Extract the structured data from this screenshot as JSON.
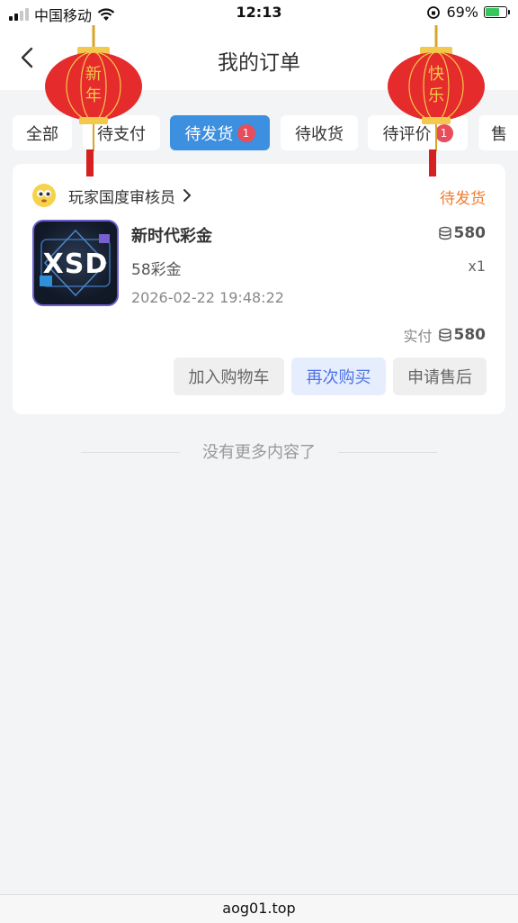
{
  "status_bar": {
    "carrier": "中国移动",
    "time": "12:13",
    "battery_percent": "69%",
    "battery_level": 0.69
  },
  "nav": {
    "title": "我的订单"
  },
  "decor": {
    "lantern_left": [
      "新",
      "年"
    ],
    "lantern_right": [
      "快",
      "乐"
    ]
  },
  "tabs": [
    {
      "label": "全部",
      "badge": ""
    },
    {
      "label": "待支付",
      "badge": ""
    },
    {
      "label": "待发货",
      "badge": "1"
    },
    {
      "label": "待收货",
      "badge": ""
    },
    {
      "label": "待评价",
      "badge": "1"
    },
    {
      "label": "售",
      "badge": ""
    }
  ],
  "order": {
    "shop_name": "玩家国度审核员",
    "status": "待发货",
    "thumbnail_text": "XSD",
    "product_name": "新时代彩金",
    "price": "580",
    "spec": "58彩金",
    "quantity": "x1",
    "time": "2026-02-22 19:48:22",
    "paid_label": "实付",
    "paid_amount": "580",
    "buttons": {
      "add_to_cart": "加入购物车",
      "buy_again": "再次购买",
      "after_sales": "申请售后"
    }
  },
  "list_end_text": "没有更多内容了",
  "url": "aog01.top",
  "colors": {
    "accent": "#3d8fe0",
    "status_orange": "#f07a2e",
    "badge_red": "#e84d5b",
    "buy_again_blue": "#4e74e6"
  }
}
